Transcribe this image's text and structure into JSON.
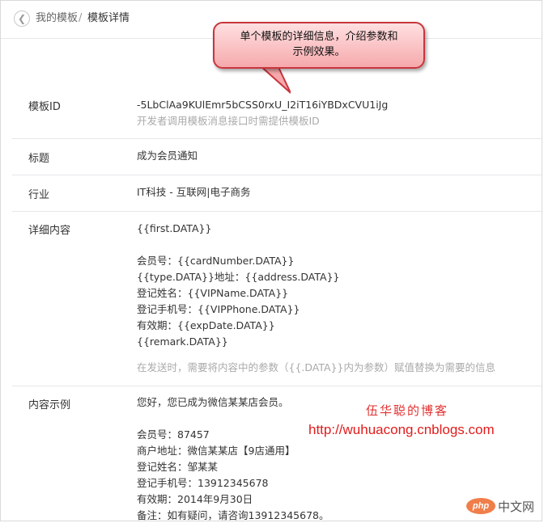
{
  "breadcrumb": {
    "back_icon": "chevron-left-icon",
    "parent": "我的模板",
    "separator": "/",
    "current": "模板详情"
  },
  "callout": {
    "line1": "单个模板的详细信息，介绍参数和",
    "line2": "示例效果。"
  },
  "details": {
    "template_id": {
      "label": "模板ID",
      "value": "-5LbClAa9KUlEmr5bCSS0rxU_I2iT16iYBDxCVU1iJg",
      "note": "开发者调用模板消息接口时需提供模板ID"
    },
    "title": {
      "label": "标题",
      "value": "成为会员通知"
    },
    "industry": {
      "label": "行业",
      "value": "IT科技 - 互联网|电子商务"
    },
    "content": {
      "label": "详细内容",
      "first": "{{first.DATA}}",
      "lines": [
        "会员号：{{cardNumber.DATA}}",
        "{{type.DATA}}地址：{{address.DATA}}",
        "登记姓名：{{VIPName.DATA}}",
        "登记手机号：{{VIPPhone.DATA}}",
        "有效期：{{expDate.DATA}}",
        "{{remark.DATA}}"
      ],
      "note": "在发送时，需要将内容中的参数（{{.DATA}}内为参数）赋值替换为需要的信息"
    },
    "example": {
      "label": "内容示例",
      "first": "您好，您已成为微信某某店会员。",
      "lines": [
        "会员号：87457",
        "商户地址：微信某某店【9店通用】",
        "登记姓名：邹某某",
        "登记手机号：13912345678",
        "有效期：2014年9月30日",
        "备注：如有疑问，请咨询13912345678。"
      ]
    }
  },
  "watermark": {
    "name": "伍华聪的博客",
    "url": "http://wuhuacong.cnblogs.com",
    "badge_logo": "php",
    "badge_text": "中文网"
  },
  "colors": {
    "callout_border": "#c8353d",
    "callout_fill": "#f6a9ac",
    "watermark_red": "#e21b1b",
    "muted_text": "#aaaaaa"
  }
}
